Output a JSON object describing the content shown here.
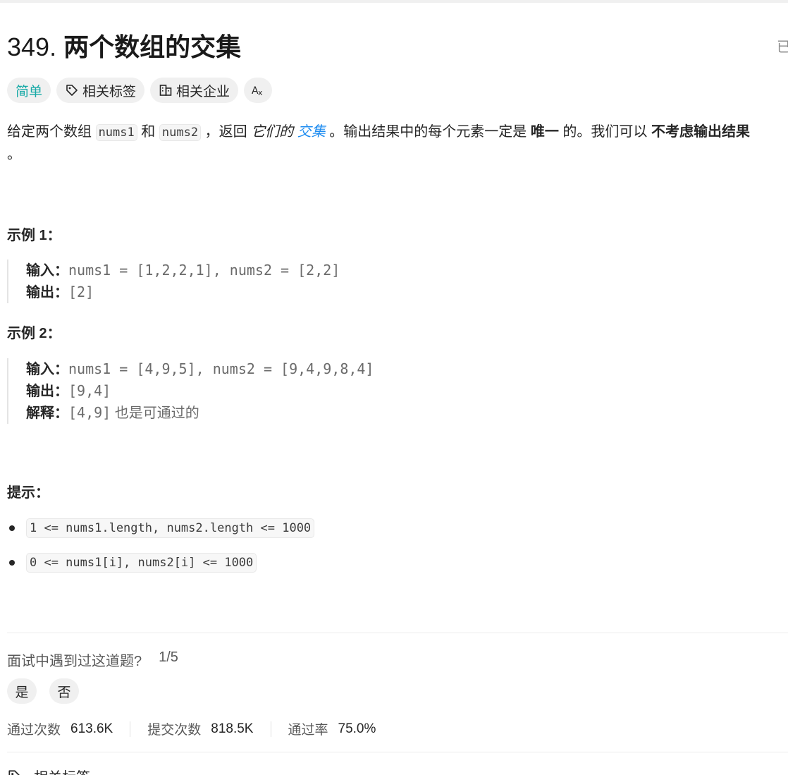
{
  "problem": {
    "number": "349.",
    "title": "两个数组的交集",
    "solved_mark": "已"
  },
  "tags": {
    "difficulty": "简单",
    "related_tags": "相关标签",
    "related_companies": "相关企业",
    "translate_icon": "translate-icon"
  },
  "description": {
    "p1_a": "给定两个数组 ",
    "code1": "nums1",
    "p1_b": " 和 ",
    "code2": "nums2",
    "p1_c": " ，返回 ",
    "em1": "它们的",
    "link": "交集",
    "p1_d": " 。输出结果中的每个元素一定是 ",
    "bold1": "唯一",
    "p1_e": " 的。我们可以 ",
    "bold2": "不考虑输出结果",
    "p2": "。"
  },
  "example1": {
    "heading": "示例 1：",
    "input_label": "输入：",
    "input_value": "nums1 = [1,2,2,1], nums2 = [2,2]",
    "output_label": "输出：",
    "output_value": "[2]"
  },
  "example2": {
    "heading": "示例 2：",
    "input_label": "输入：",
    "input_value": "nums1 = [4,9,5], nums2 = [9,4,9,8,4]",
    "output_label": "输出：",
    "output_value": "[9,4]",
    "explain_label": "解释：",
    "explain_code": "[4,9]",
    "explain_text": " 也是可通过的"
  },
  "hints": {
    "heading": "提示：",
    "items": [
      "1 <= nums1.length, nums2.length <= 1000",
      "0 <= nums1[i], nums2[i] <= 1000"
    ]
  },
  "interview": {
    "question": "面试中遇到过这道题?",
    "count": "1/5",
    "yes": "是",
    "no": "否"
  },
  "stats": {
    "accepted_label": "通过次数",
    "accepted_value": "613.6K",
    "submitted_label": "提交次数",
    "submitted_value": "818.5K",
    "rate_label": "通过率",
    "rate_value": "75.0%"
  },
  "bottom": {
    "related_tags": "相关标签",
    "icon": "tag-icon"
  }
}
